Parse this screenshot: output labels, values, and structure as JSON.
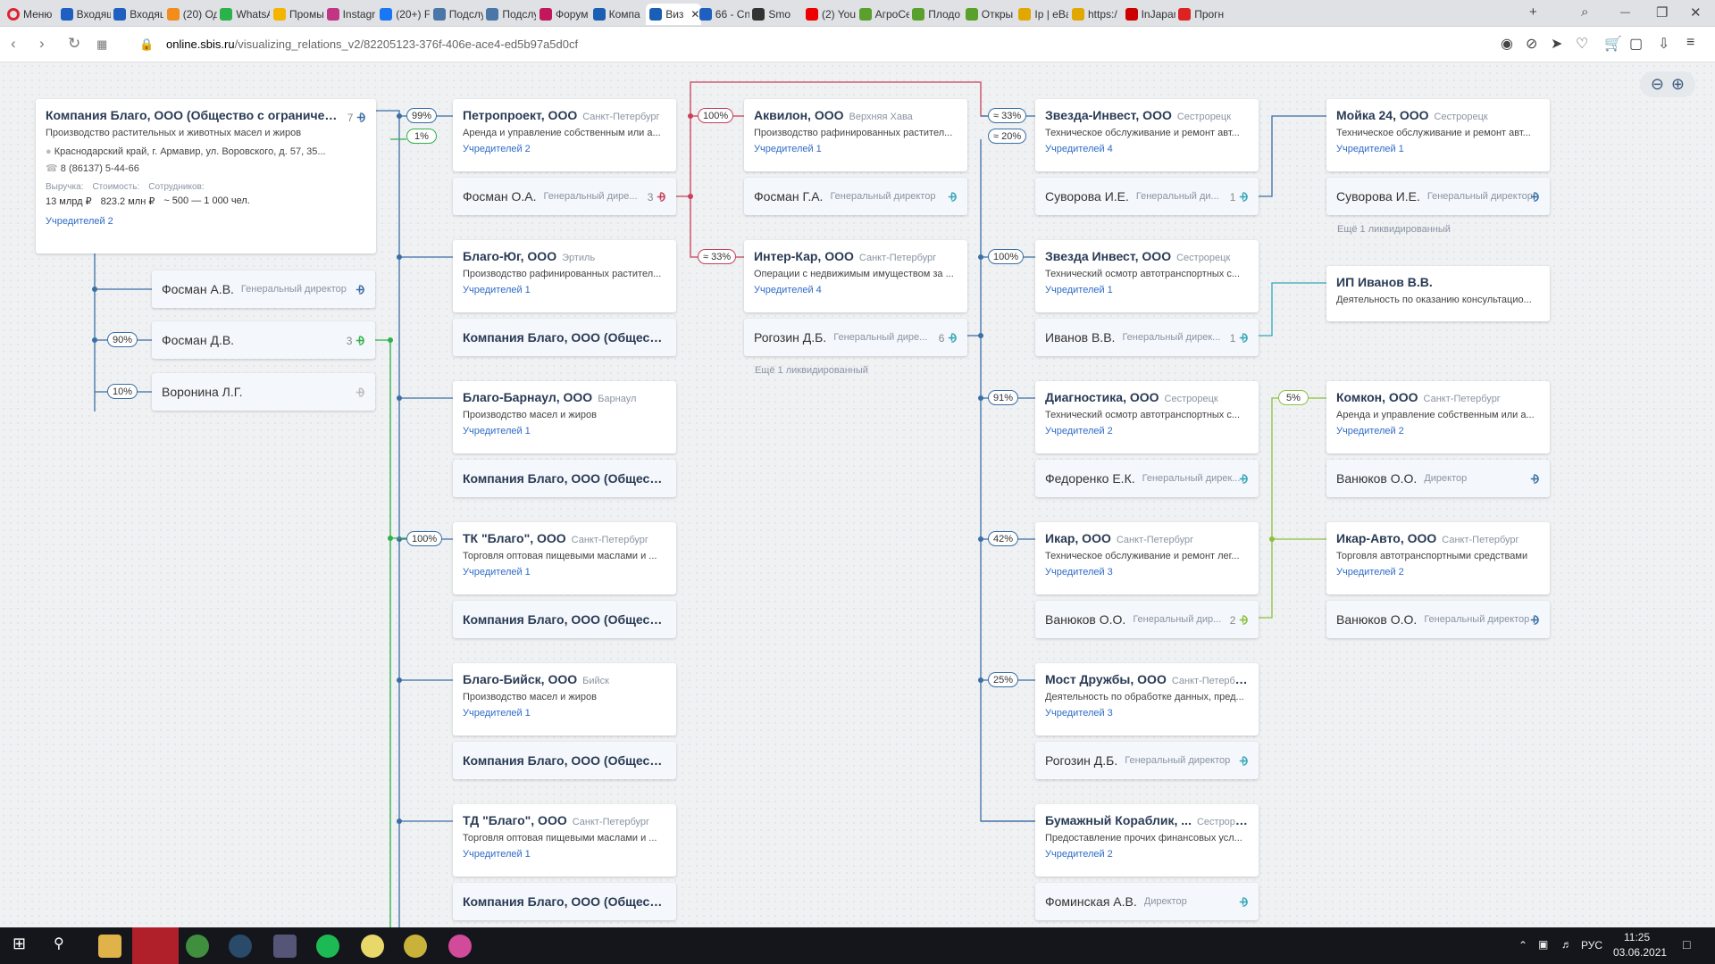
{
  "tabs": [
    {
      "label": "Меню",
      "icon": "opera-menu-icon"
    },
    {
      "label": "Входящ",
      "icon": "mail-icon"
    },
    {
      "label": "Входящ",
      "icon": "mail-icon"
    },
    {
      "label": "(20) Од",
      "icon": "ok-icon"
    },
    {
      "label": "WhatsA",
      "icon": "whatsapp-icon"
    },
    {
      "label": "Промы",
      "icon": "drive-icon"
    },
    {
      "label": "Instagr",
      "icon": "instagram-icon"
    },
    {
      "label": "(20+) F",
      "icon": "facebook-icon"
    },
    {
      "label": "Подслу",
      "icon": "vk-icon"
    },
    {
      "label": "Подслу",
      "icon": "vk-icon"
    },
    {
      "label": "Форум",
      "icon": "forum-icon"
    },
    {
      "label": "Компа",
      "icon": "sbis-icon"
    },
    {
      "label": "Виз",
      "icon": "sbis-icon",
      "active": true
    },
    {
      "label": "66 - Cn",
      "icon": "mail-icon"
    },
    {
      "label": "Smo",
      "icon": "media-icon"
    },
    {
      "label": "(2) You",
      "icon": "youtube-icon"
    },
    {
      "label": "АгроСе",
      "icon": "leaf-icon"
    },
    {
      "label": "Плодо",
      "icon": "leaf-icon"
    },
    {
      "label": "Откры",
      "icon": "leaf-icon"
    },
    {
      "label": "Ip | eBa",
      "icon": "ebay-icon"
    },
    {
      "label": "https:/",
      "icon": "ebay-icon"
    },
    {
      "label": "InJapan",
      "icon": "injapan-icon"
    },
    {
      "label": "Прогн",
      "icon": "umbrella-icon"
    }
  ],
  "address": {
    "domain": "online.sbis.ru",
    "path": "/visualizing_relations_v2/82205123-376f-406e-ace4-ed5b97a5d0cf"
  },
  "root": {
    "name": "Компания Благо, ООО (Общество с ограниченн...",
    "count": "7",
    "activity": "Производство растительных и животных масел и жиров",
    "address": "Краснодарский край, г. Армавир, ул. Воровского, д. 57, 35...",
    "phone": "8 (86137) 5-44-66",
    "stat_labels": [
      "Выручка:",
      "Стоимость:",
      "Сотрудников:"
    ],
    "stat_values": [
      "13 млрд ₽",
      "823.2 млн ₽",
      "~ 500 — 1 000 чел."
    ],
    "founders": "Учредителей 2"
  },
  "root_people": [
    {
      "name": "Фосман А.В.",
      "role": "Генеральный директор",
      "count": "",
      "badge": ""
    },
    {
      "name": "Фосман Д.В.",
      "role": "",
      "count": "3",
      "badge": "90%"
    },
    {
      "name": "Воронина Л.Г.",
      "role": "",
      "count": "",
      "badge": "10%"
    }
  ],
  "col1": [
    {
      "name": "Петропроект, ООО",
      "city": "Санкт-Петербург",
      "activity": "Аренда и управление собственным или а...",
      "founders": "Учредителей 2",
      "person": "Фосман О.А.",
      "role": "Генеральный дире...",
      "pcount": "3",
      "badge": "99%"
    },
    {
      "name": "Благо-Юг, ООО",
      "city": "Эртиль",
      "activity": "Производство рафинированных растител...",
      "founders": "Учредителей 1",
      "person": "Компания Благо, ООО (Обществ...",
      "role": "",
      "pcount": "",
      "badge": ""
    },
    {
      "name": "Благо-Барнаул, ООО",
      "city": "Барнаул",
      "activity": "Производство масел и жиров",
      "founders": "Учредителей 1",
      "person": "Компания Благо, ООО (Обществ...",
      "role": "",
      "pcount": "",
      "badge": ""
    },
    {
      "name": "ТК \"Благо\", ООО",
      "city": "Санкт-Петербург",
      "activity": "Торговля оптовая пищевыми маслами и ...",
      "founders": "Учредителей 1",
      "person": "Компания Благо, ООО (Обществ...",
      "role": "",
      "pcount": "",
      "badge": "100%"
    },
    {
      "name": "Благо-Бийск, ООО",
      "city": "Бийск",
      "activity": "Производство масел и жиров",
      "founders": "Учредителей 1",
      "person": "Компания Благо, ООО (Обществ...",
      "role": "",
      "pcount": "",
      "badge": ""
    },
    {
      "name": "ТД \"Благо\", ООО",
      "city": "Санкт-Петербург",
      "activity": "Торговля оптовая пищевыми маслами и ...",
      "founders": "Учредителей 1",
      "person": "Компания Благо, ООО (Обществ...",
      "role": "",
      "pcount": "",
      "badge": ""
    }
  ],
  "extra_badge": "1%",
  "col2": [
    {
      "name": "Аквилон, ООО",
      "city": "Верхняя Хава",
      "activity": "Производство рафинированных растител...",
      "founders": "Учредителей 1",
      "person": "Фосман Г.А.",
      "role": "Генеральный директор",
      "pcount": "",
      "badge": "100%"
    },
    {
      "name": "Интер-Кар, ООО",
      "city": "Санкт-Петербург",
      "activity": "Операции с недвижимым имуществом за ...",
      "founders": "Учредителей 4",
      "person": "Рогозин Д.Б.",
      "role": "Генеральный дире...",
      "pcount": "6",
      "badge": "≈ 33%"
    }
  ],
  "col2_liquidated": "Ещё 1 ликвидированный",
  "col3": [
    {
      "name": "Звезда-Инвест, ООО",
      "city": "Сестрорецк",
      "activity": "Техническое обслуживание и ремонт авт...",
      "founders": "Учредителей 4",
      "person": "Суворова И.Е.",
      "role": "Генеральный ди...",
      "pcount": "1",
      "badge": "≈ 33%"
    },
    {
      "name": "Звезда Инвест, ООО",
      "city": "Сестрорецк",
      "activity": "Технический осмотр автотранспортных с...",
      "founders": "Учредителей 1",
      "person": "Иванов В.В.",
      "role": "Генеральный дирек...",
      "pcount": "1",
      "badge": "100%"
    },
    {
      "name": "Диагностика, ООО",
      "city": "Сестрорецк",
      "activity": "Технический осмотр автотранспортных с...",
      "founders": "Учредителей 2",
      "person": "Федоренко Е.К.",
      "role": "Генеральный дирек...",
      "pcount": "",
      "badge": "91%"
    },
    {
      "name": "Икар, ООО",
      "city": "Санкт-Петербург",
      "activity": "Техническое обслуживание и ремонт лег...",
      "founders": "Учредителей 3",
      "person": "Ванюков О.О.",
      "role": "Генеральный дир...",
      "pcount": "2",
      "badge": "42%"
    },
    {
      "name": "Мост Дружбы, ООО",
      "city": "Санкт-Петербург",
      "activity": "Деятельность по обработке данных, пред...",
      "founders": "Учредителей 3",
      "person": "Рогозин Д.Б.",
      "role": "Генеральный директор",
      "pcount": "",
      "badge": "25%"
    },
    {
      "name": "Бумажный Кораблик, ...",
      "city": "Сестрорецк",
      "activity": "Предоставление прочих финансовых усл...",
      "founders": "Учредителей 2",
      "person": "Фоминская А.В.",
      "role": "Директор",
      "pcount": "",
      "badge": ""
    }
  ],
  "col3_extra_badge": "≈ 20%",
  "col4": [
    {
      "name": "Мойка 24, ООО",
      "city": "Сестрорецк",
      "activity": "Техническое обслуживание и ремонт авт...",
      "founders": "Учредителей 1",
      "person": "Суворова И.Е.",
      "role": "Генеральный директор",
      "badge": ""
    },
    {
      "name": "ИП Иванов В.В.",
      "city": "",
      "activity": "Деятельность по оказанию консультацио...",
      "founders": "",
      "person": "",
      "role": "",
      "badge": ""
    },
    {
      "name": "Комкон, ООО",
      "city": "Санкт-Петербург",
      "activity": "Аренда и управление собственным или а...",
      "founders": "Учредителей 2",
      "person": "Ванюков О.О.",
      "role": "Директор",
      "badge": "5%"
    },
    {
      "name": "Икар-Авто, ООО",
      "city": "Санкт-Петербург",
      "activity": "Торговля автотранспортными средствами",
      "founders": "Учредителей 2",
      "person": "Ванюков О.О.",
      "role": "Генеральный директор",
      "badge": ""
    }
  ],
  "col4_liquidated": "Ещё 1 ликвидированный",
  "colors": {
    "blue": "#3a6ea5",
    "green": "#2fb04a",
    "red": "#c6405a",
    "teal": "#35a6b8",
    "lime": "#8cbf3f",
    "link": "#2e6bc6"
  },
  "clock": {
    "time": "11:25",
    "date": "03.06.2021",
    "lang": "РУС"
  }
}
